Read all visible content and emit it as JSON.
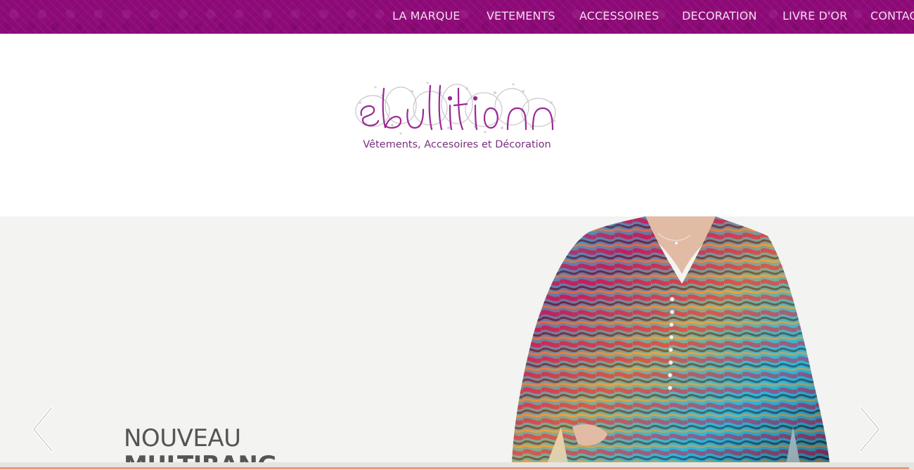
{
  "nav": {
    "items": [
      {
        "label": "LA MARQUE"
      },
      {
        "label": "VETEMENTS"
      },
      {
        "label": "ACCESSOIRES"
      },
      {
        "label": "DECORATION"
      },
      {
        "label": "LIVRE D'OR"
      },
      {
        "label": "CONTACT"
      }
    ]
  },
  "brand": {
    "logo_text": "ebullition",
    "tagline": "Vêtements, Accesoires et Décoration"
  },
  "slider": {
    "caption_line1": "NOUVEAU",
    "caption_line2": "MULTIRANG",
    "prev_icon": "chevron-left-icon",
    "next_icon": "chevron-right-icon"
  },
  "colors": {
    "nav_background": "#8e0a78",
    "logo_purple": "#9a2a94",
    "tagline": "#7a2f7f",
    "slider_background": "#f3f3f1",
    "accent_line": "#e39a7e"
  }
}
